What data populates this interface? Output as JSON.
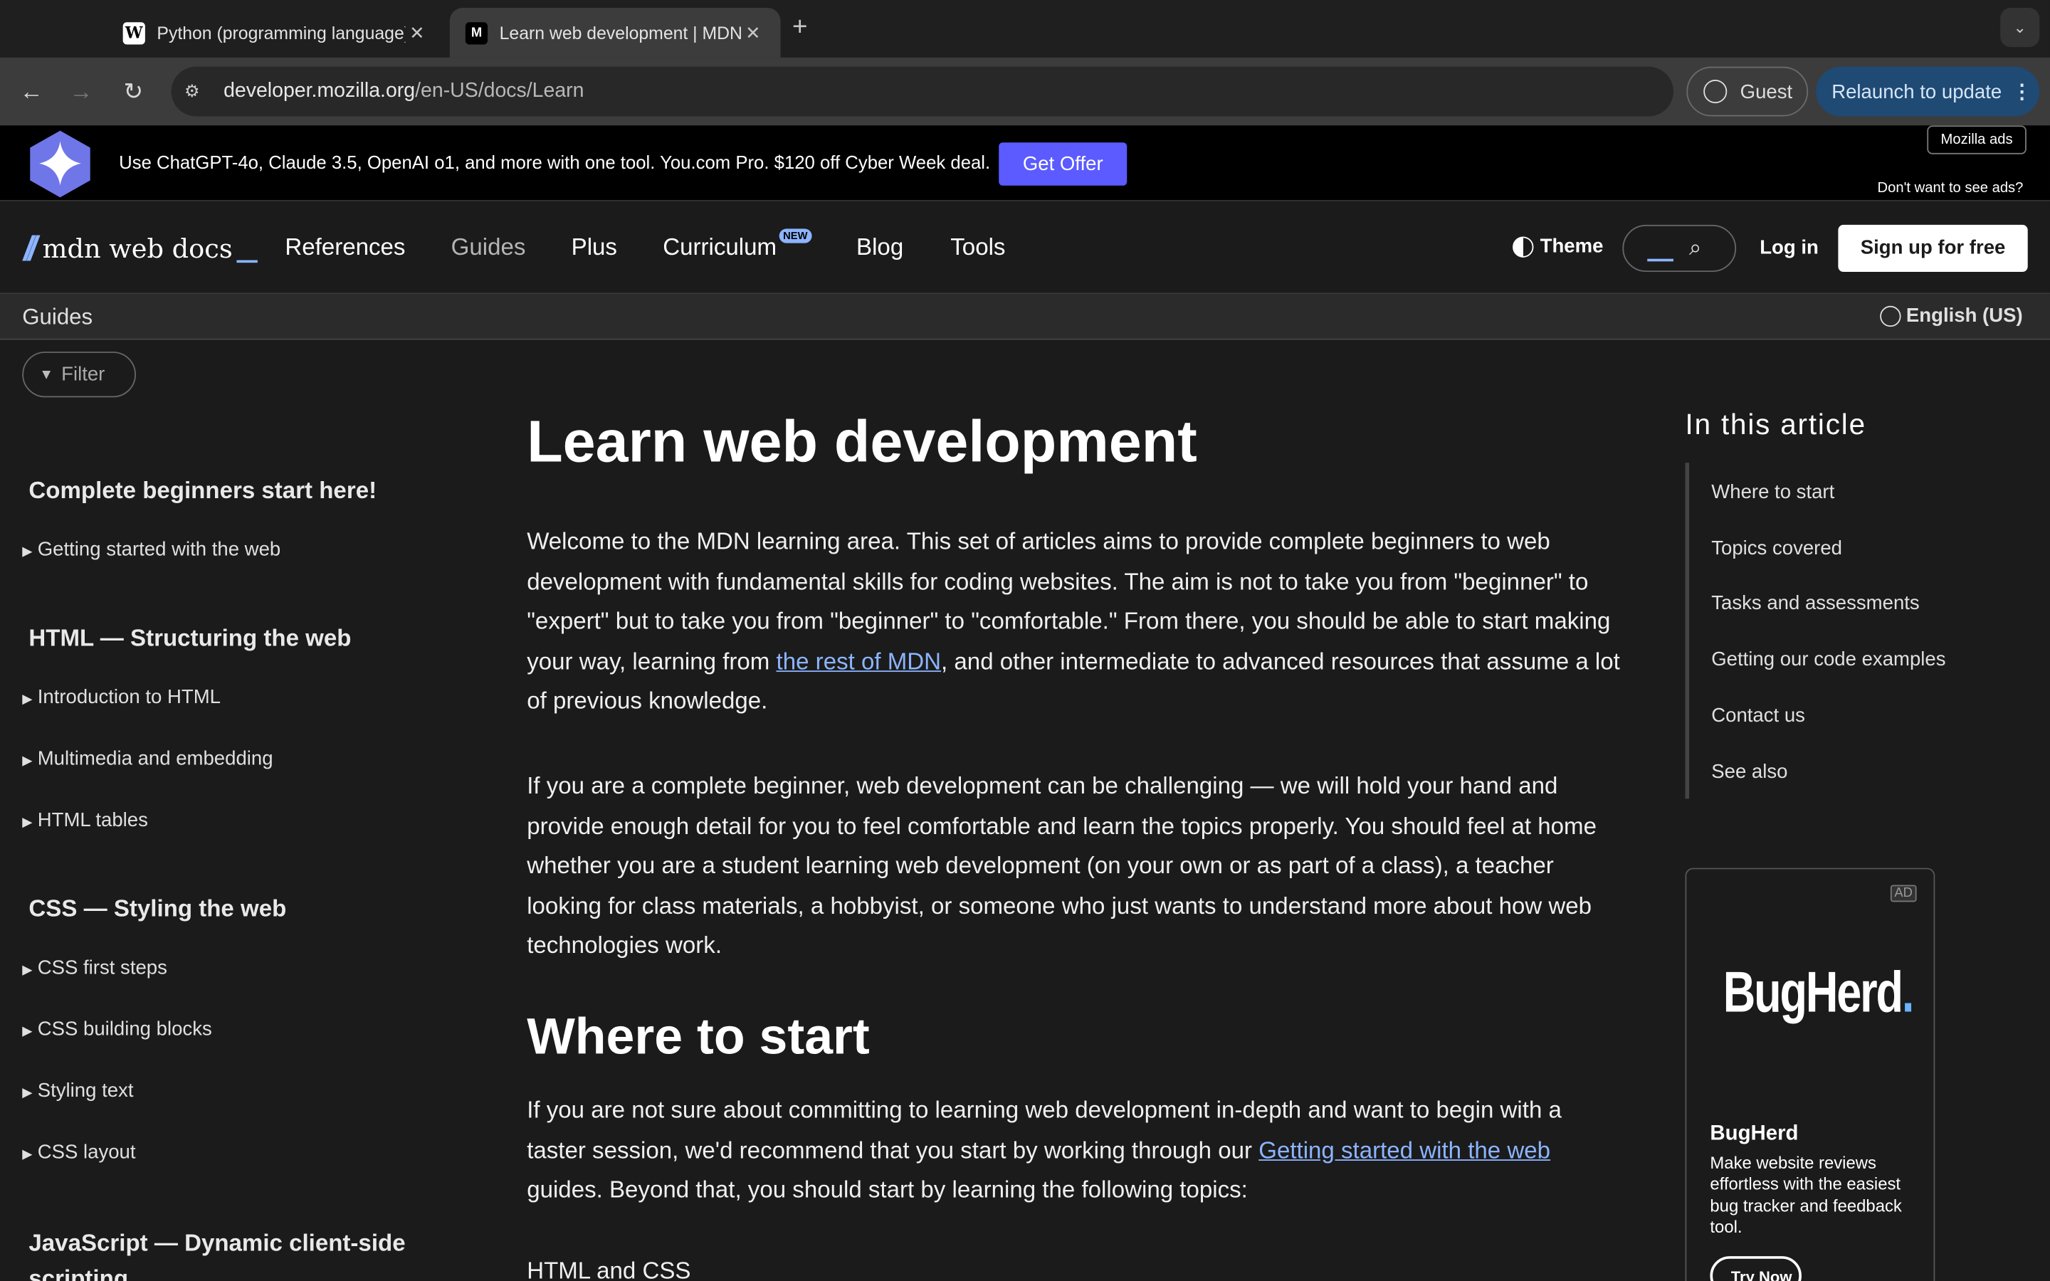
{
  "browser": {
    "tabs": [
      {
        "title": "Python (programming language)",
        "favicon": "W",
        "active": false
      },
      {
        "title": "Learn web development | MDN",
        "favicon": "M",
        "active": true
      }
    ],
    "url_host": "developer.mozilla.org",
    "url_path": "/en-US/docs/Learn",
    "guest_label": "Guest",
    "relaunch_label": "Relaunch to update"
  },
  "ad_banner": {
    "text": "Use ChatGPT-4o, Claude 3.5, OpenAI o1, and more with one tool. You.com Pro. $120 off Cyber Week deal.",
    "cta": "Get Offer",
    "mozilla_ads": "Mozilla ads",
    "dont_want": "Don't want to see ads?"
  },
  "header": {
    "logo_text": "mdn web docs",
    "nav": [
      "References",
      "Guides",
      "Plus",
      "Curriculum",
      "Blog",
      "Tools"
    ],
    "curriculum_badge": "NEW",
    "theme_label": "Theme",
    "login_label": "Log in",
    "signup_label": "Sign up for free"
  },
  "breadcrumb": {
    "current": "Guides",
    "language": "English (US)"
  },
  "sidebar": {
    "filter_label": "Filter",
    "sections": [
      {
        "title": "Complete beginners start here!",
        "items": [
          "Getting started with the web"
        ]
      },
      {
        "title": "HTML — Structuring the web",
        "items": [
          "Introduction to HTML",
          "Multimedia and embedding",
          "HTML tables"
        ]
      },
      {
        "title": "CSS — Styling the web",
        "items": [
          "CSS first steps",
          "CSS building blocks",
          "Styling text",
          "CSS layout"
        ]
      },
      {
        "title": "JavaScript — Dynamic client-side scripting",
        "items": []
      }
    ]
  },
  "main": {
    "title": "Learn web development",
    "p1_before": "Welcome to the MDN learning area. This set of articles aims to provide complete beginners to web development with fundamental skills for coding websites. The aim is not to take you from \"beginner\" to \"expert\" but to take you from \"beginner\" to \"comfortable.\" From there, you should be able to start making your way, learning from ",
    "p1_link": "the rest of MDN",
    "p1_after": ", and other intermediate to advanced resources that assume a lot of previous knowledge.",
    "p2": "If you are a complete beginner, web development can be challenging — we will hold your hand and provide enough detail for you to feel comfortable and learn the topics properly. You should feel at home whether you are a student learning web development (on your own or as part of a class), a teacher looking for class materials, a hobbyist, or someone who just wants to understand more about how web technologies work.",
    "h2": "Where to start",
    "p3_before": "If you are not sure about committing to learning web development in-depth and want to begin with a taster session, we'd recommend that you start by working through our ",
    "p3_link": "Getting started with the web",
    "p3_after": " guides. Beyond that, you should start by learning the following topics:",
    "h3": "HTML and CSS"
  },
  "toc": {
    "title": "In this article",
    "items": [
      "Where to start",
      "Topics covered",
      "Tasks and assessments",
      "Getting our code examples",
      "Contact us",
      "See also"
    ]
  },
  "ad_card": {
    "tag": "AD",
    "brand": "BugHerd",
    "brand_dot": ".",
    "name": "BugHerd",
    "desc": "Make website reviews effortless with the easiest bug tracker and feedback tool.",
    "cta": "Try Now"
  }
}
